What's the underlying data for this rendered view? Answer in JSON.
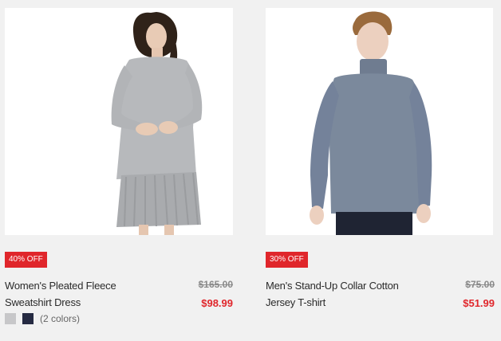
{
  "products": [
    {
      "discount": "40% OFF",
      "name_line1": "Women's Pleated Fleece",
      "name_line2": "Sweatshirt Dress",
      "old_price": "$165.00",
      "new_price": "$98.99",
      "swatch_colors": [
        "#c7c7c9",
        "#252a42"
      ],
      "colors_count": "(2 colors)",
      "image": "woman-grey-sweatshirt-dress"
    },
    {
      "discount": "30% OFF",
      "name_line1": "Men's Stand-Up Collar Cotton",
      "name_line2": "Jersey T-shirt",
      "old_price": "$75.00",
      "new_price": "$51.99",
      "image": "man-blue-grey-long-sleeve-shirt"
    }
  ],
  "colors": {
    "sale_red": "#e0262b",
    "background": "#f1f1f1"
  }
}
